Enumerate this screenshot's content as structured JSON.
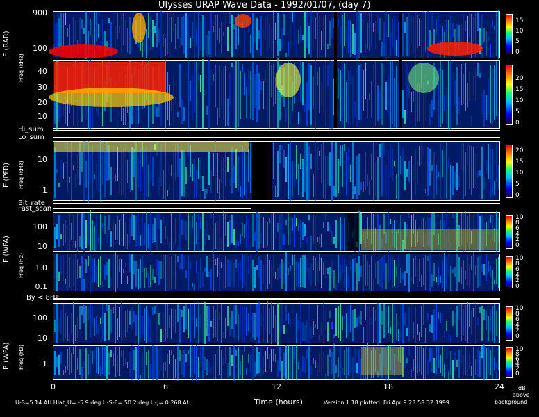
{
  "title": "Ulysses URAP Wave Data - 1992/01/07, (day 7)",
  "chart_data": {
    "type": "heatmap",
    "title": "Ulysses URAP Wave Data - 1992/01/07, (day 7)",
    "xlabel": "Time (hours)",
    "xlim": [
      0,
      24
    ],
    "x_ticks": [
      "0",
      "6",
      "12",
      "18",
      "24"
    ],
    "colorbar_unit": [
      "dB",
      "above",
      "background"
    ],
    "panels": [
      {
        "id": "rar-high",
        "ylabel": "E (RAR)",
        "y_ticks": [
          "900",
          "100"
        ],
        "log_scale": true,
        "colorbar_ticks": [
          "15",
          "10",
          "5",
          "0"
        ]
      },
      {
        "id": "rar-low",
        "ylabel": "Freq (kHz)",
        "y_ticks": [
          "40",
          "30",
          "20",
          "10"
        ],
        "log_scale": false,
        "colorbar_ticks": [
          "20",
          "15",
          "10",
          "5",
          "0"
        ]
      },
      {
        "id": "pfr",
        "ylabel": "E (PFR)",
        "sublabel": "Freq (kHz)",
        "y_ticks": [
          "10",
          "1"
        ],
        "log_scale": true,
        "colorbar_ticks": [
          "20",
          "15",
          "10",
          "5",
          "0"
        ]
      },
      {
        "id": "wfa-e-high",
        "ylabel": "E (WFA)",
        "sublabel": "Freq (Hz)",
        "y_ticks": [
          "100",
          "10"
        ],
        "log_scale": true,
        "colorbar_ticks": [
          "10",
          "8",
          "6",
          "4",
          "2",
          "0"
        ]
      },
      {
        "id": "wfa-e-low",
        "ylabel": "",
        "y_ticks": [
          "1.0",
          "0.1"
        ],
        "log_scale": true,
        "colorbar_ticks": [
          "10",
          "8",
          "6",
          "4",
          "2",
          "0"
        ]
      },
      {
        "id": "wfa-b-high",
        "ylabel": "B (WFA)",
        "sublabel": "Freq (Hz)",
        "y_ticks": [
          "100",
          "10"
        ],
        "log_scale": true,
        "colorbar_ticks": [
          "10",
          "8",
          "6",
          "4",
          "2",
          "0"
        ]
      },
      {
        "id": "wfa-b-low",
        "ylabel": "",
        "y_ticks": [
          "1"
        ],
        "log_scale": true,
        "colorbar_ticks": [
          "10",
          "8",
          "6",
          "4",
          "2",
          "0"
        ]
      }
    ],
    "data_gaps_hours": [
      [
        10.5,
        11.4
      ],
      [
        15.2,
        15.3
      ],
      [
        18.8,
        18.9
      ]
    ],
    "intense_regions": [
      {
        "panel": "rar-low",
        "from_hours": 0.2,
        "to_hours": 6.5,
        "level_db": 20
      },
      {
        "panel": "rar-high",
        "from_hours": 0.5,
        "to_hours": 3.5,
        "level_db": 15
      },
      {
        "panel": "rar-high",
        "from_hours": 20.5,
        "to_hours": 23.0,
        "level_db": 15
      }
    ]
  },
  "indicators": {
    "hi_sum": "Hi_sum",
    "lo_sum": "Lo_sum",
    "bit_rate": "Bit_rate",
    "fast_scan": "Fast_scan",
    "by_8hz": "By < 8Hz"
  },
  "footer": {
    "position": "U-S=5.14 AU   Hlat_U= -5.9 deg   U-S-E= 50.2 deg   U-J= 0.268 AU",
    "version": "Version 1.18 plotted: Fri Apr  9 23:58:32 1999",
    "db": "dB",
    "above": "above",
    "background": "background"
  }
}
